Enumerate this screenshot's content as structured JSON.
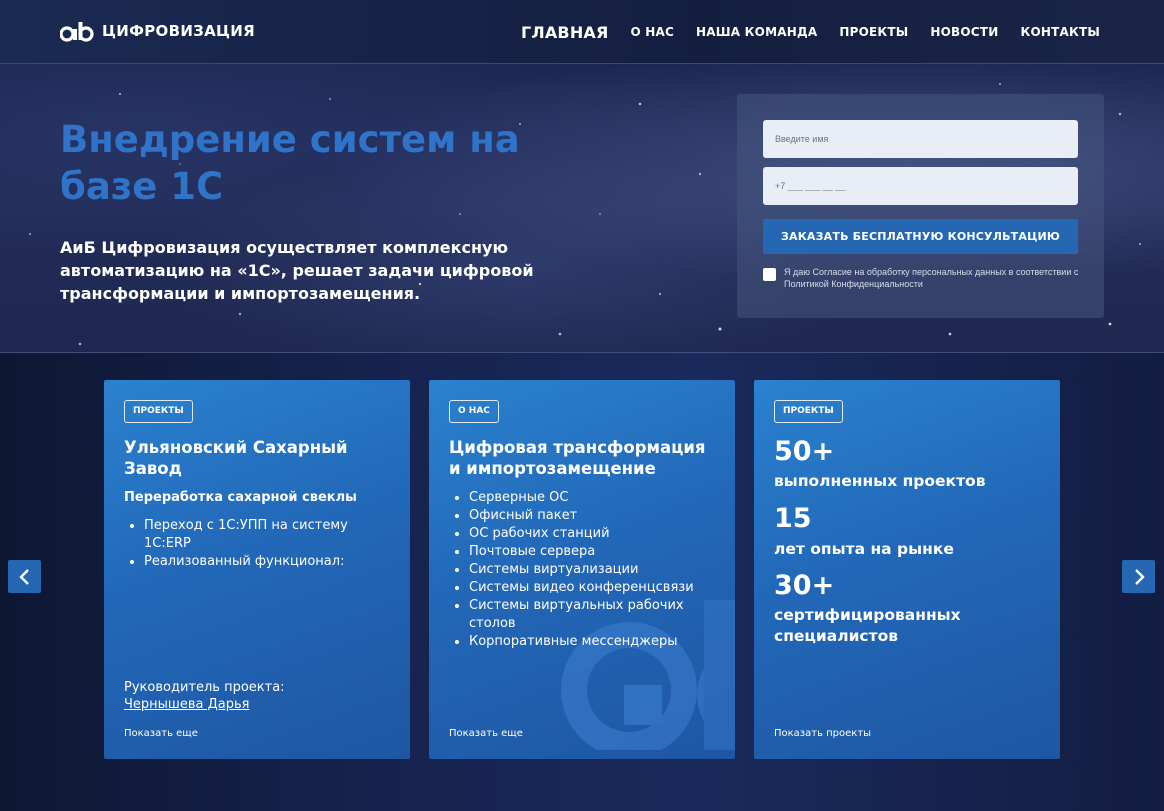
{
  "header": {
    "brand": "ЦИФРОВИЗАЦИЯ",
    "nav": [
      "ГЛАВНАЯ",
      "О НАС",
      "НАША КОМАНДА",
      "ПРОЕКТЫ",
      "НОВОСТИ",
      "КОНТАКТЫ"
    ]
  },
  "hero": {
    "title": "Внедрение систем на базе 1С",
    "subtitle": "АиБ Цифровизация осуществляет комплексную автоматизацию на «1С», решает задачи цифровой трансформации и импортозамещения."
  },
  "form": {
    "name_placeholder": "Введите имя",
    "phone_placeholder": "+7 ___ ___ __ __",
    "submit_label": "ЗАКАЗАТЬ БЕСПЛАТНУЮ КОНСУЛЬТАЦИЮ",
    "consent_text": "Я даю Согласие на обработку персональных данных в соответствии с Политикой Конфиденциальности"
  },
  "cards": [
    {
      "tag": "ПРОЕКТЫ",
      "title": "Ульяновский Сахарный Завод",
      "subtitle": "Переработка сахарной свеклы",
      "bullets": [
        "Переход с 1С:УПП на систему 1С:ERP",
        "Реализованный функционал:"
      ],
      "lead_label": "Руководитель проекта:",
      "lead_name": "Чернышева Дарья",
      "more": "Показать еще"
    },
    {
      "tag": "О НАС",
      "title": "Цифровая трансформация и импортозамещение",
      "bullets": [
        "Серверные ОС",
        "Офисный пакет",
        "ОС рабочих станций",
        "Почтовые сервера",
        "Системы виртуализации",
        "Системы видео конференцсвязи",
        "Системы виртуальных рабочих столов",
        "Корпоративные мессенджеры"
      ],
      "more": "Показать еще"
    },
    {
      "tag": "ПРОЕКТЫ",
      "stats": [
        {
          "num": "50+",
          "label": "выполненных проектов"
        },
        {
          "num": "15",
          "label": "лет опыта на рынке"
        },
        {
          "num": "30+",
          "label": "сертифицированных специалистов"
        }
      ],
      "more": "Показать проекты"
    }
  ],
  "colors": {
    "accent": "#2567b3",
    "title_blue": "#2f74c8",
    "card_blue": "#2268b8"
  },
  "icons": [
    "logo-mark-icon",
    "chevron-left-icon",
    "chevron-right-icon"
  ]
}
